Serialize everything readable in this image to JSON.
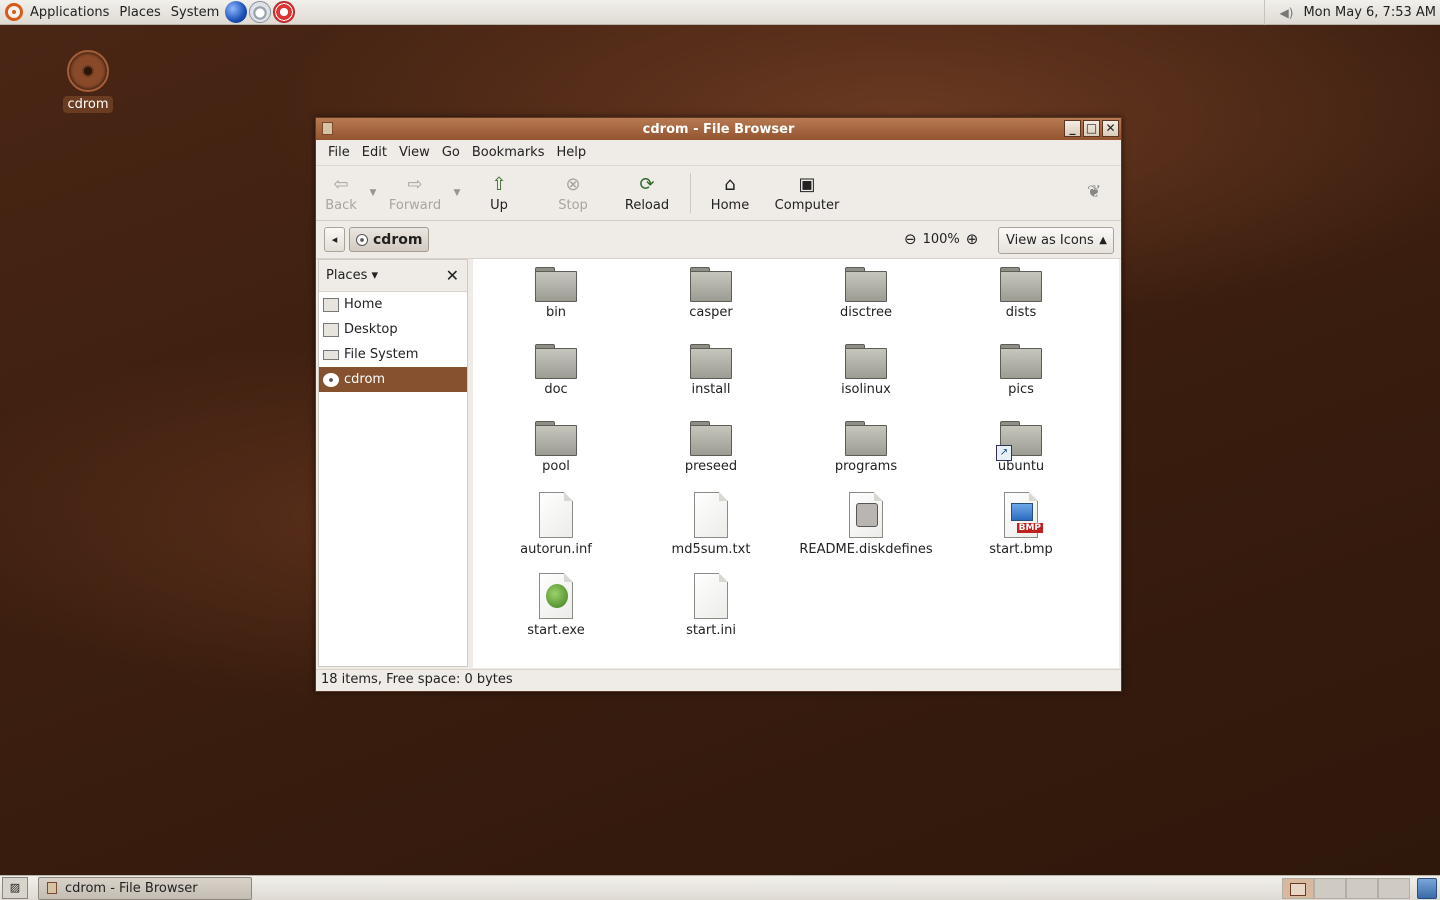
{
  "top_panel": {
    "menus": [
      "Applications",
      "Places",
      "System"
    ],
    "launchers": [
      "globe-icon",
      "mail-icon",
      "help-icon"
    ],
    "clock": "Mon May  6,  7:53 AM"
  },
  "desktop": {
    "icons": [
      {
        "label": "cdrom",
        "icon": "cdrom-icon"
      }
    ]
  },
  "window": {
    "title": "cdrom - File Browser",
    "menubar": [
      "File",
      "Edit",
      "View",
      "Go",
      "Bookmarks",
      "Help"
    ],
    "toolbar": {
      "back": "Back",
      "forward": "Forward",
      "up": "Up",
      "stop": "Stop",
      "reload": "Reload",
      "home": "Home",
      "computer": "Computer"
    },
    "location": {
      "crumb": "cdrom",
      "zoom": "100%",
      "view_mode": "View as Icons"
    },
    "sidebar": {
      "title": "Places",
      "items": [
        {
          "label": "Home",
          "icon": "home-folder-icon"
        },
        {
          "label": "Desktop",
          "icon": "desktop-icon"
        },
        {
          "label": "File System",
          "icon": "drive-icon"
        },
        {
          "label": "cdrom",
          "icon": "cdrom-icon",
          "selected": true
        }
      ]
    },
    "files": [
      {
        "name": "bin",
        "type": "folder"
      },
      {
        "name": "casper",
        "type": "folder"
      },
      {
        "name": "disctree",
        "type": "folder"
      },
      {
        "name": "dists",
        "type": "folder"
      },
      {
        "name": "doc",
        "type": "folder"
      },
      {
        "name": "install",
        "type": "folder"
      },
      {
        "name": "isolinux",
        "type": "folder"
      },
      {
        "name": "pics",
        "type": "folder"
      },
      {
        "name": "pool",
        "type": "folder"
      },
      {
        "name": "preseed",
        "type": "folder"
      },
      {
        "name": "programs",
        "type": "folder"
      },
      {
        "name": "ubuntu",
        "type": "folder-link"
      },
      {
        "name": "autorun.inf",
        "type": "text"
      },
      {
        "name": "md5sum.txt",
        "type": "text"
      },
      {
        "name": "README.diskdefines",
        "type": "disk-doc"
      },
      {
        "name": "start.bmp",
        "type": "bmp",
        "badge": "BMP"
      },
      {
        "name": "start.exe",
        "type": "exe"
      },
      {
        "name": "start.ini",
        "type": "text"
      }
    ],
    "status": "18 items, Free space: 0 bytes"
  },
  "bottom_panel": {
    "task": "cdrom - File Browser",
    "workspaces": 4,
    "active_workspace": 1
  },
  "colors": {
    "selection": "#85512f",
    "titlebar": "#a86a45",
    "desktop": "#3d1f10"
  }
}
